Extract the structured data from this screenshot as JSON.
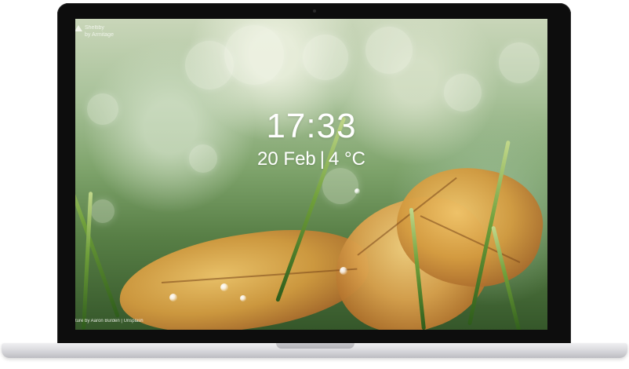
{
  "app": {
    "name": "Sheltiby",
    "author": "by Armitage"
  },
  "clock": {
    "time": "17:33"
  },
  "date_weather": {
    "date": "20 Feb",
    "separator": "|",
    "temperature": "4 °C"
  },
  "credit": {
    "text": "ture by Aaron Burden | Unsplash"
  },
  "colors": {
    "lid": "#0d0d0d",
    "base": "#d8d8dc",
    "text": "#ffffff"
  }
}
